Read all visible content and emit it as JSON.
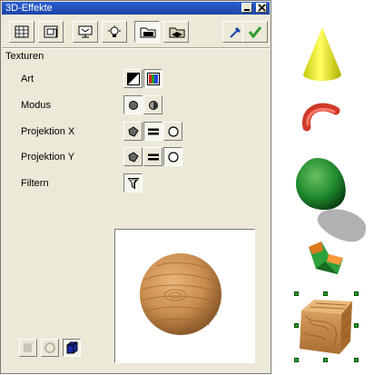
{
  "window": {
    "title": "3D-Effekte"
  },
  "tabs": [
    {
      "icon": "geometry-icon"
    },
    {
      "icon": "shading-icon"
    },
    {
      "icon": "illumination-icon"
    },
    {
      "icon": "lighting-icon"
    },
    {
      "icon": "textures-icon",
      "selected": true
    },
    {
      "icon": "material-icon"
    }
  ],
  "toolbar": {
    "assign_icon": "pipette-icon",
    "apply_icon": "checkmark-icon"
  },
  "textures": {
    "section_label": "Texturen",
    "rows": {
      "art": "Art",
      "modus": "Modus",
      "projektion_x": "Projektion X",
      "projektion_y": "Projektion Y",
      "filtern": "Filtern"
    }
  },
  "colors": {
    "title_bar": "#2355c4",
    "dialog_bg": "#ece9d8",
    "cone": "#f1f125",
    "torus": "#e84a3a",
    "blob": "#1f8a2d",
    "selection_handle": "#1aa41a",
    "wood": "#c98d4e"
  },
  "scene_objects": [
    "cone",
    "torus-segment",
    "green-sphere",
    "shadow",
    "bent-shape",
    "wooden-cube"
  ]
}
